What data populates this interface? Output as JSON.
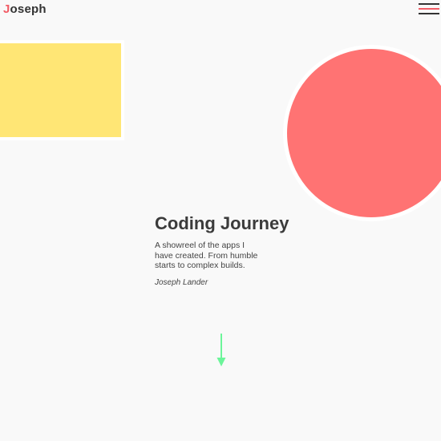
{
  "header": {
    "logo_initial": "J",
    "logo_rest": "oseph",
    "menu_icon": "hamburger-menu-icon"
  },
  "hero": {
    "title": "Coding Journey",
    "description": "A showreel of the apps I have created. From humble starts to complex builds.",
    "author": "Joseph Lander"
  },
  "scroll": {
    "icon": "arrow-down-icon"
  },
  "colors": {
    "background": "#f9f9f9",
    "accent_red": "#f25c66",
    "circle_red": "#ff7373",
    "rect_yellow": "#ffe675",
    "arrow_green": "#6cf59a",
    "text_dark": "#3b3b3b"
  }
}
